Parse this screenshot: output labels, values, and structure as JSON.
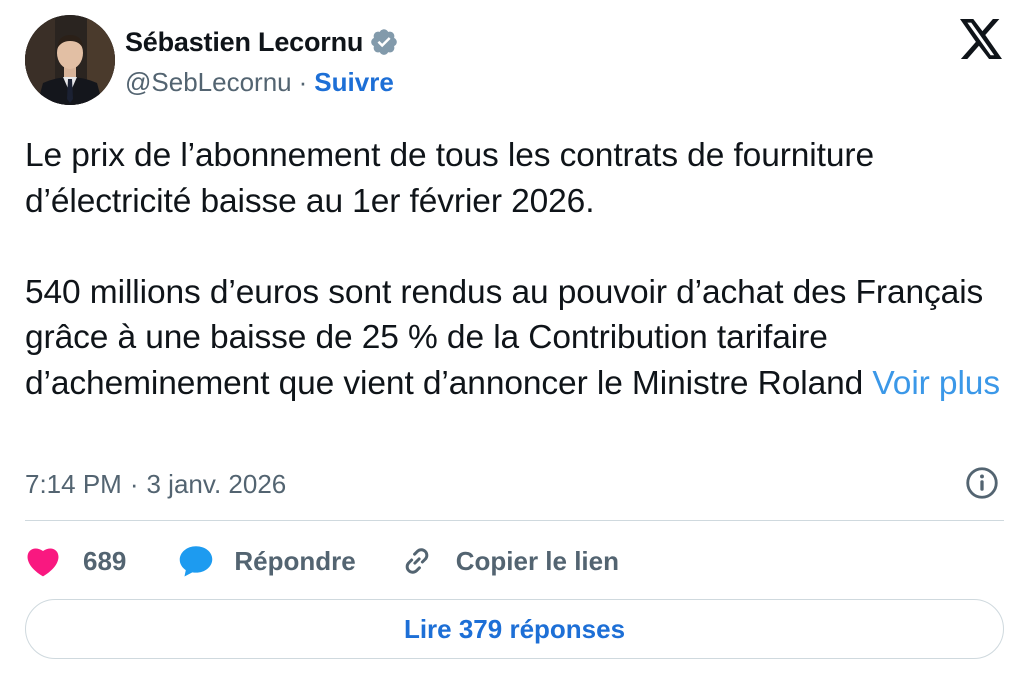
{
  "author": {
    "name": "Sébastien Lecornu",
    "handle": "@SebLecornu",
    "separator": "·",
    "follow_label": "Suivre",
    "verified_icon": "verified-badge-icon",
    "avatar": "profile-photo"
  },
  "platform": {
    "logo_icon": "x-logo-icon"
  },
  "tweet": {
    "paragraph1": "Le prix de l’abonnement de tous les contrats de fourniture d’électricité baisse au 1er février 2026.",
    "paragraph2": "540 millions d’euros sont rendus au pouvoir d’achat des Français grâce à une baisse de 25 % de la Contribution tarifaire d’acheminement que vient d’annoncer le Ministre Roland",
    "see_more_label": "Voir plus"
  },
  "meta": {
    "time": "7:14 PM",
    "separator": "·",
    "date": "3 janv. 2026",
    "info_icon": "info-icon"
  },
  "actions": {
    "like_count": "689",
    "reply_label": "Répondre",
    "copy_label": "Copier le lien",
    "like_icon": "heart-icon",
    "reply_icon": "speech-bubble-icon",
    "copy_icon": "link-icon"
  },
  "footer": {
    "read_replies_label": "Lire 379 réponses"
  },
  "colors": {
    "link_blue": "#1d6fd6",
    "see_more_blue": "#3b98e8",
    "heart_pink": "#f91880",
    "secondary_text": "#536471",
    "primary_text": "#0f1419"
  }
}
